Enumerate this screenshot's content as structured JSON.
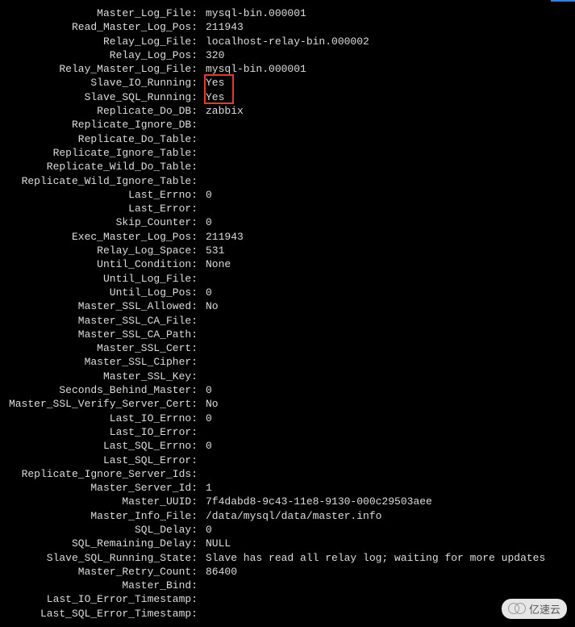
{
  "rows": [
    {
      "label": "Master_Log_File:",
      "value": "mysql-bin.000001"
    },
    {
      "label": "Read_Master_Log_Pos:",
      "value": "211943"
    },
    {
      "label": "Relay_Log_File:",
      "value": "localhost-relay-bin.000002"
    },
    {
      "label": "Relay_Log_Pos:",
      "value": "320"
    },
    {
      "label": "Relay_Master_Log_File:",
      "value": "mysql-bin.000001"
    },
    {
      "label": "Slave_IO_Running:",
      "value": "Yes",
      "highlightstart": true
    },
    {
      "label": "Slave_SQL_Running:",
      "value": "Yes"
    },
    {
      "label": "Replicate_Do_DB:",
      "value": "zabbix"
    },
    {
      "label": "Replicate_Ignore_DB:",
      "value": ""
    },
    {
      "label": "Replicate_Do_Table:",
      "value": ""
    },
    {
      "label": "Replicate_Ignore_Table:",
      "value": ""
    },
    {
      "label": "Replicate_Wild_Do_Table:",
      "value": ""
    },
    {
      "label": "Replicate_Wild_Ignore_Table:",
      "value": ""
    },
    {
      "label": "Last_Errno:",
      "value": "0"
    },
    {
      "label": "Last_Error:",
      "value": ""
    },
    {
      "label": "Skip_Counter:",
      "value": "0"
    },
    {
      "label": "Exec_Master_Log_Pos:",
      "value": "211943"
    },
    {
      "label": "Relay_Log_Space:",
      "value": "531"
    },
    {
      "label": "Until_Condition:",
      "value": "None"
    },
    {
      "label": "Until_Log_File:",
      "value": ""
    },
    {
      "label": "Until_Log_Pos:",
      "value": "0"
    },
    {
      "label": "Master_SSL_Allowed:",
      "value": "No"
    },
    {
      "label": "Master_SSL_CA_File:",
      "value": ""
    },
    {
      "label": "Master_SSL_CA_Path:",
      "value": ""
    },
    {
      "label": "Master_SSL_Cert:",
      "value": ""
    },
    {
      "label": "Master_SSL_Cipher:",
      "value": ""
    },
    {
      "label": "Master_SSL_Key:",
      "value": ""
    },
    {
      "label": "Seconds_Behind_Master:",
      "value": "0"
    },
    {
      "label": "Master_SSL_Verify_Server_Cert:",
      "value": "No"
    },
    {
      "label": "Last_IO_Errno:",
      "value": "0"
    },
    {
      "label": "Last_IO_Error:",
      "value": ""
    },
    {
      "label": "Last_SQL_Errno:",
      "value": "0"
    },
    {
      "label": "Last_SQL_Error:",
      "value": ""
    },
    {
      "label": "Replicate_Ignore_Server_Ids:",
      "value": ""
    },
    {
      "label": "Master_Server_Id:",
      "value": "1"
    },
    {
      "label": "Master_UUID:",
      "value": "7f4dabd8-9c43-11e8-9130-000c29503aee"
    },
    {
      "label": "Master_Info_File:",
      "value": "/data/mysql/data/master.info"
    },
    {
      "label": "SQL_Delay:",
      "value": "0"
    },
    {
      "label": "SQL_Remaining_Delay:",
      "value": "NULL"
    },
    {
      "label": "Slave_SQL_Running_State:",
      "value": "Slave has read all relay log; waiting for more updates"
    },
    {
      "label": "Master_Retry_Count:",
      "value": "86400"
    },
    {
      "label": "Master_Bind:",
      "value": ""
    },
    {
      "label": "Last_IO_Error_Timestamp:",
      "value": ""
    },
    {
      "label": "Last_SQL_Error_Timestamp:",
      "value": ""
    }
  ],
  "watermark": "亿速云"
}
